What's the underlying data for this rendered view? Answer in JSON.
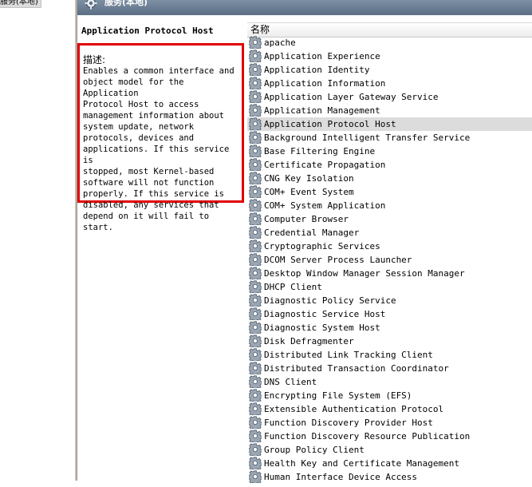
{
  "tree": {
    "node_label": "服务(本地)"
  },
  "header": {
    "title": "服务(本地)",
    "icon": "gear-icon"
  },
  "description": {
    "service_name": "Application Protocol Host",
    "label": "描述:",
    "text": "Enables a common interface and\nobject model for the Application\nProtocol Host to access\nmanagement information about\nsystem update, network\nprotocols, devices and\napplications. If this service is\nstopped, most Kernel-based\nsoftware will not function\nproperly. If this service is\ndisabled, any services that\ndepend on it will fail to start."
  },
  "list": {
    "column_header": "名称",
    "selected_index": 6,
    "selection_color": "#dcdcdc",
    "highlight_border_color": "#e00000",
    "services": [
      "apache",
      "Application Experience",
      "Application Identity",
      "Application Information",
      "Application Layer Gateway Service",
      "Application Management",
      "Application Protocol Host",
      "Background Intelligent Transfer Service",
      "Base Filtering Engine",
      "Certificate Propagation",
      "CNG Key Isolation",
      "COM+ Event System",
      "COM+ System Application",
      "Computer Browser",
      "Credential Manager",
      "Cryptographic Services",
      "DCOM Server Process Launcher",
      "Desktop Window Manager Session Manager",
      "DHCP Client",
      "Diagnostic Policy Service",
      "Diagnostic Service Host",
      "Diagnostic System Host",
      "Disk Defragmenter",
      "Distributed Link Tracking Client",
      "Distributed Transaction Coordinator",
      "DNS Client",
      "Encrypting File System (EFS)",
      "Extensible Authentication Protocol",
      "Function Discovery Provider Host",
      "Function Discovery Resource Publication",
      "Group Policy Client",
      "Health Key and Certificate Management",
      "Human Interface Device Access"
    ]
  }
}
